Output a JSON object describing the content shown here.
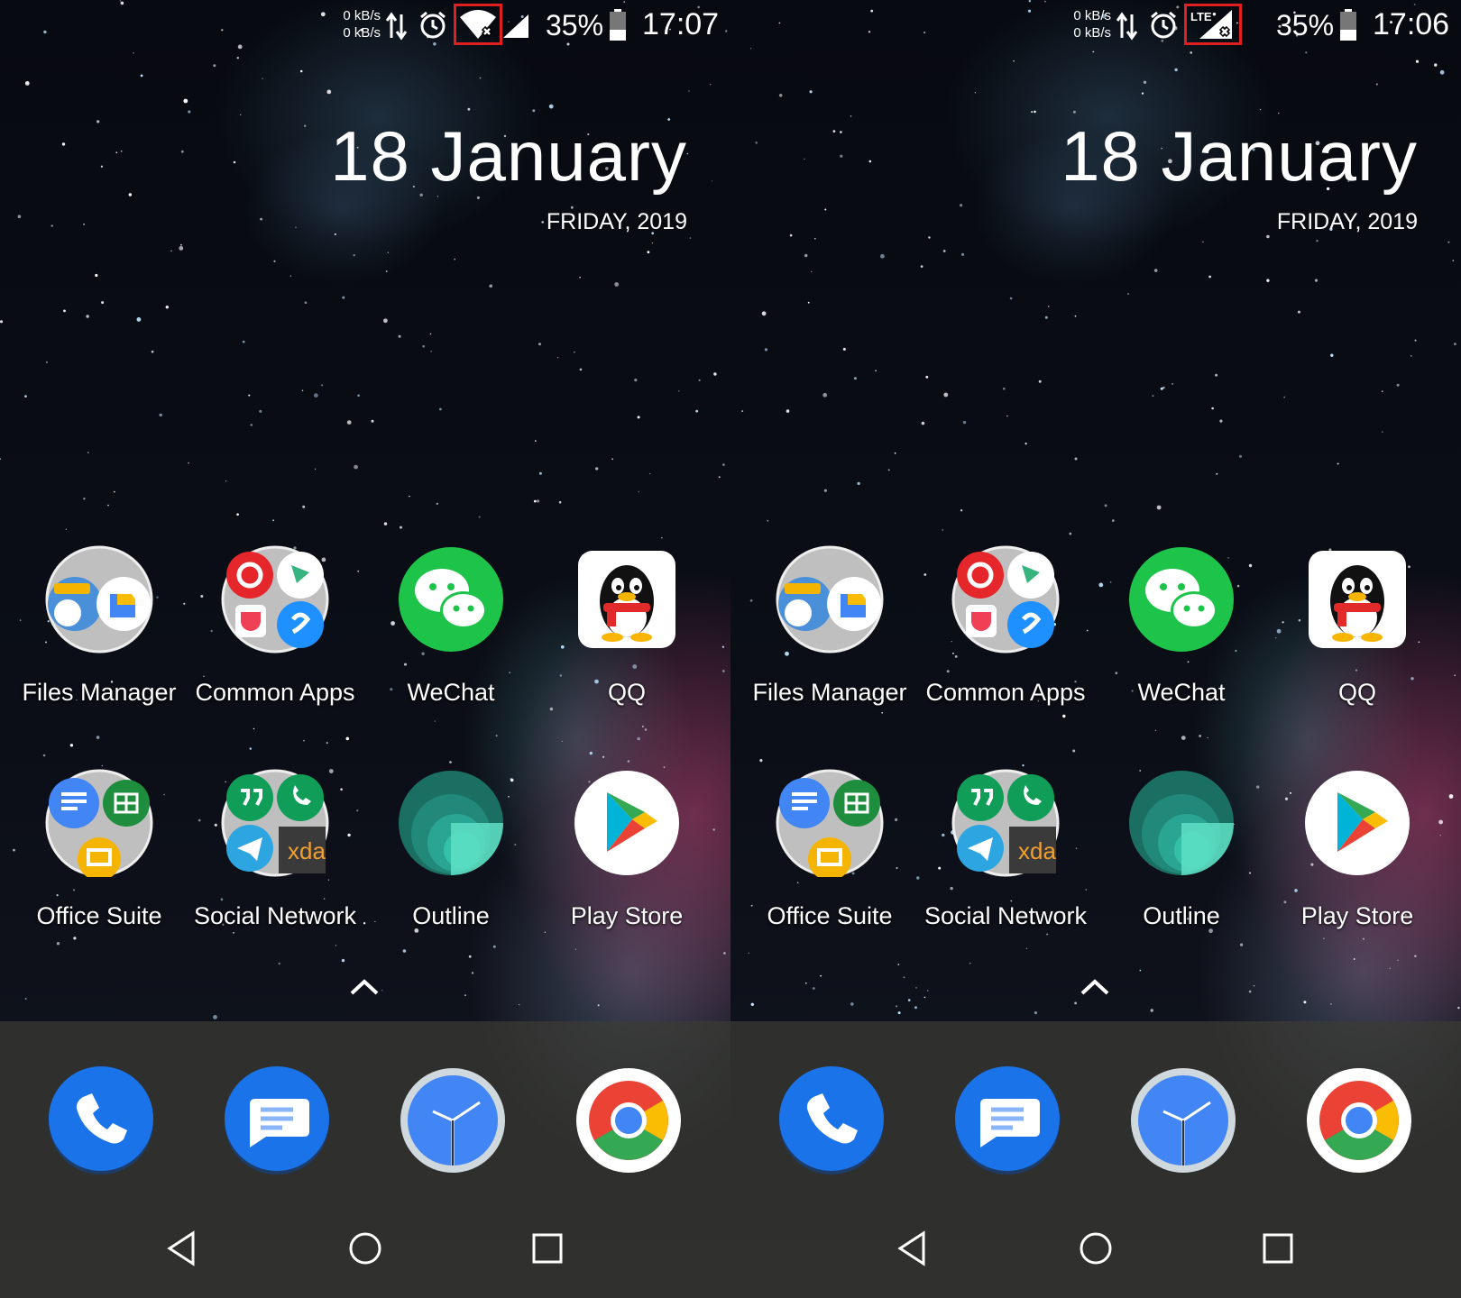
{
  "screens": [
    {
      "status_bar": {
        "net_up": "0 kB/s",
        "net_down": "0 kB/s",
        "network_indicator": "wifi-off-icon",
        "battery_percent": "35%",
        "time": "17:07"
      },
      "date_widget": {
        "date": "18 January",
        "weekday_year": "FRIDAY, 2019"
      },
      "apps": [
        {
          "label": "Files Manager",
          "icon": "files-manager-folder-icon"
        },
        {
          "label": "Common Apps",
          "icon": "common-apps-folder-icon"
        },
        {
          "label": "WeChat",
          "icon": "wechat-icon"
        },
        {
          "label": "QQ",
          "icon": "qq-icon"
        },
        {
          "label": "Office Suite",
          "icon": "office-suite-folder-icon"
        },
        {
          "label": "Social Network",
          "icon": "social-network-folder-icon"
        },
        {
          "label": "Outline",
          "icon": "outline-icon"
        },
        {
          "label": "Play Store",
          "icon": "play-store-icon"
        }
      ],
      "dock": [
        "phone-icon",
        "messages-icon",
        "clock-icon",
        "chrome-icon"
      ]
    },
    {
      "status_bar": {
        "net_up": "0 kB/s",
        "net_down": "0 kB/s",
        "network_indicator": "lte-no-signal-icon",
        "network_label": "LTE",
        "battery_percent": "35%",
        "time": "17:06"
      },
      "date_widget": {
        "date": "18 January",
        "weekday_year": "FRIDAY, 2019"
      },
      "apps": [
        {
          "label": "Files Manager",
          "icon": "files-manager-folder-icon"
        },
        {
          "label": "Common Apps",
          "icon": "common-apps-folder-icon"
        },
        {
          "label": "WeChat",
          "icon": "wechat-icon"
        },
        {
          "label": "QQ",
          "icon": "qq-icon"
        },
        {
          "label": "Office Suite",
          "icon": "office-suite-folder-icon"
        },
        {
          "label": "Social Network",
          "icon": "social-network-folder-icon"
        },
        {
          "label": "Outline",
          "icon": "outline-icon"
        },
        {
          "label": "Play Store",
          "icon": "play-store-icon"
        }
      ],
      "dock": [
        "phone-icon",
        "messages-icon",
        "clock-icon",
        "chrome-icon"
      ]
    }
  ],
  "theme": {
    "highlight_box": "#e02020",
    "phone_blue": "#1a73e8",
    "wechat_green": "#1ec44a"
  },
  "xda_text": "xda"
}
